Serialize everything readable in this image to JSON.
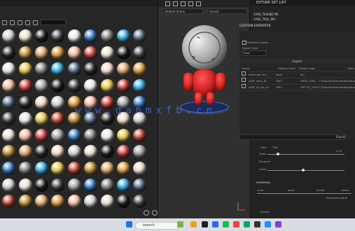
{
  "texture_set": {
    "header": "EXTURE SET LIST",
    "items": [
      "CASE_TEXLNE PRI",
      "CASE_TEXL_PRI"
    ]
  },
  "exporter": {
    "title": "CUSTOM EXPORTER",
    "option_label": "Dilations Gluser",
    "section_label": "Export Type",
    "dropdown_value": "Trans",
    "tab": "Export",
    "columns": [
      "Group",
      "Default Sizes",
      "Output map",
      "Data"
    ],
    "rows": [
      {
        "name": "Smpli gtd Hd...",
        "size": "Rove",
        "map": "dir_"
      },
      {
        "name": "nsRF_dot1_b1",
        "size": "3NFL",
        "map": "HKSS_1000",
        "data": "C:/Shared/Texturesalsd/ibnalss"
      },
      {
        "name": "nsRF_b2_b2_b1",
        "size": "3NFL",
        "map": "HSF H2_1000",
        "data": "C:/Shared/Texturesalsd/ibnalss"
      }
    ],
    "button": "Export"
  },
  "lower_panel": {
    "labels": [
      "Hole",
      "THG",
      "Trans",
      "Dunnum",
      "Unlos"
    ],
    "value_a": "0.12",
    "section": "SSEMENAL",
    "cols": [
      "antx",
      "antal",
      "vandk",
      "sasse"
    ],
    "flag": "Resolved cpenti",
    "footer": "Grouts"
  },
  "viewport": {
    "left_dropdown": "Default Scene",
    "right_dropdown": "Sunset"
  },
  "watermark": "www.qanmxfb.cn",
  "taskbar": {
    "search": "search"
  },
  "colors": {
    "accent": "#4a86ff",
    "robot_red": "#d42424"
  }
}
